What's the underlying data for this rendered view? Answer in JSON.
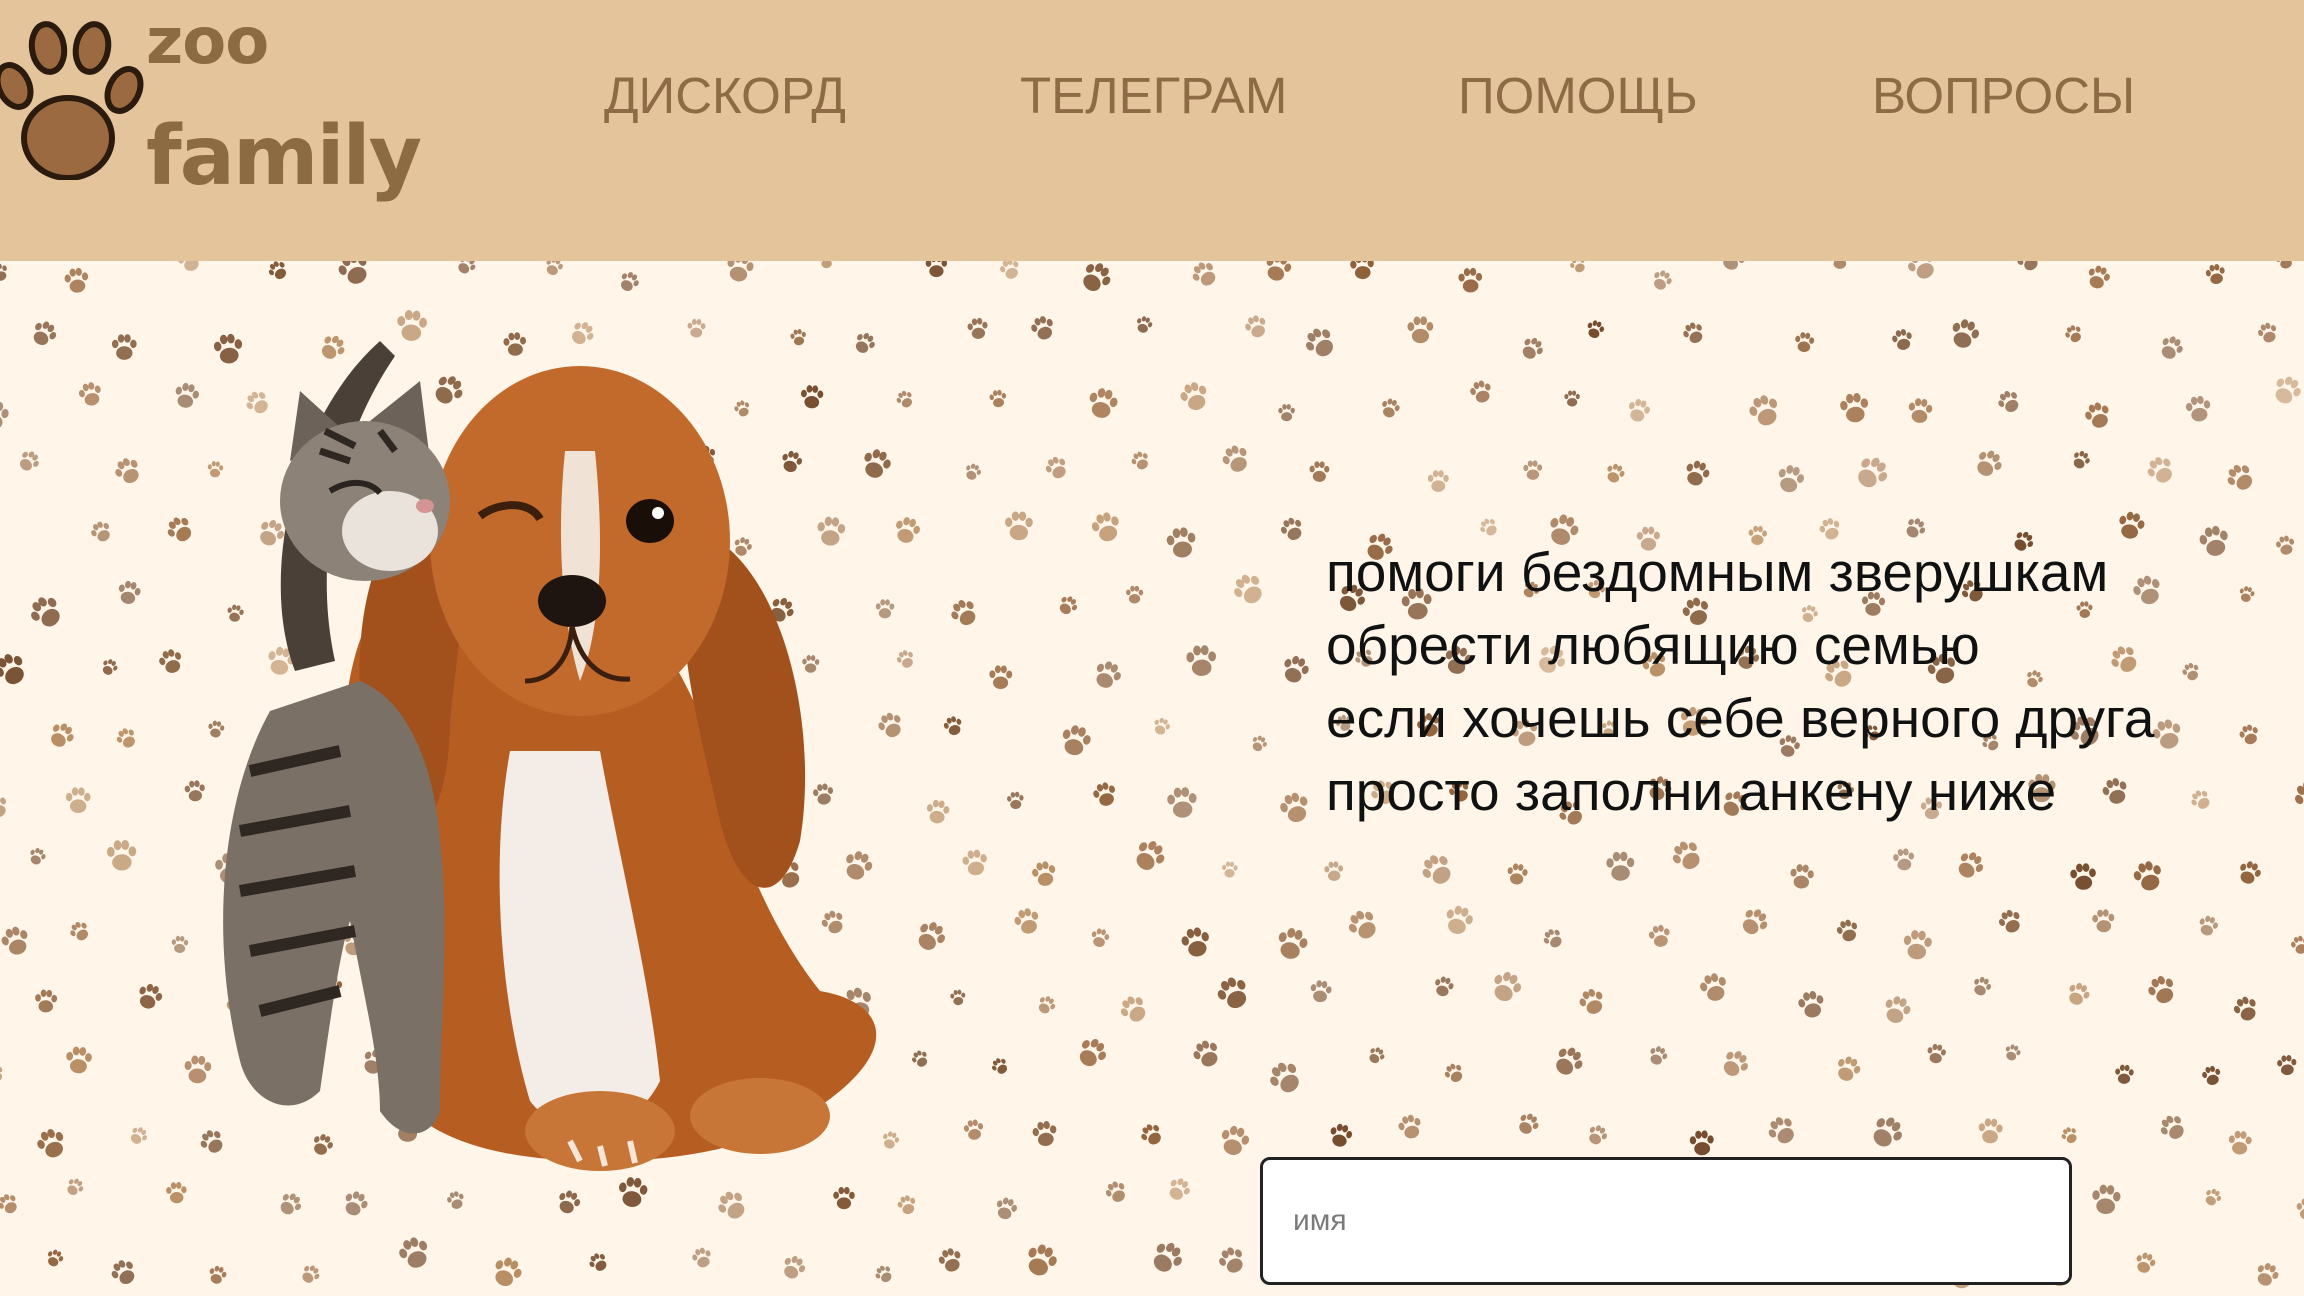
{
  "brand": {
    "line1": "zoo",
    "line2": "family",
    "color": "#8c6a42"
  },
  "nav": {
    "items": [
      {
        "label": "ДИСКОРД"
      },
      {
        "label": "ТЕЛЕГРАМ"
      },
      {
        "label": "ПОМОЩЬ"
      },
      {
        "label": "ВОПРОСЫ"
      }
    ]
  },
  "hero": {
    "tagline": [
      "помоги бездомным зверушкам",
      "обрести любящию семью",
      "если хочешь себе верного друга",
      "просто заполни анкену ниже"
    ]
  },
  "form": {
    "name_placeholder": "имя"
  },
  "colors": {
    "header_bg": "#e4c49b",
    "page_bg": "#fff5e8",
    "nav_text": "#8c6b45",
    "paw_print": "#8a5a32"
  },
  "icons": {
    "logo": "paw-icon",
    "background_pattern": "paw-print-pattern"
  }
}
